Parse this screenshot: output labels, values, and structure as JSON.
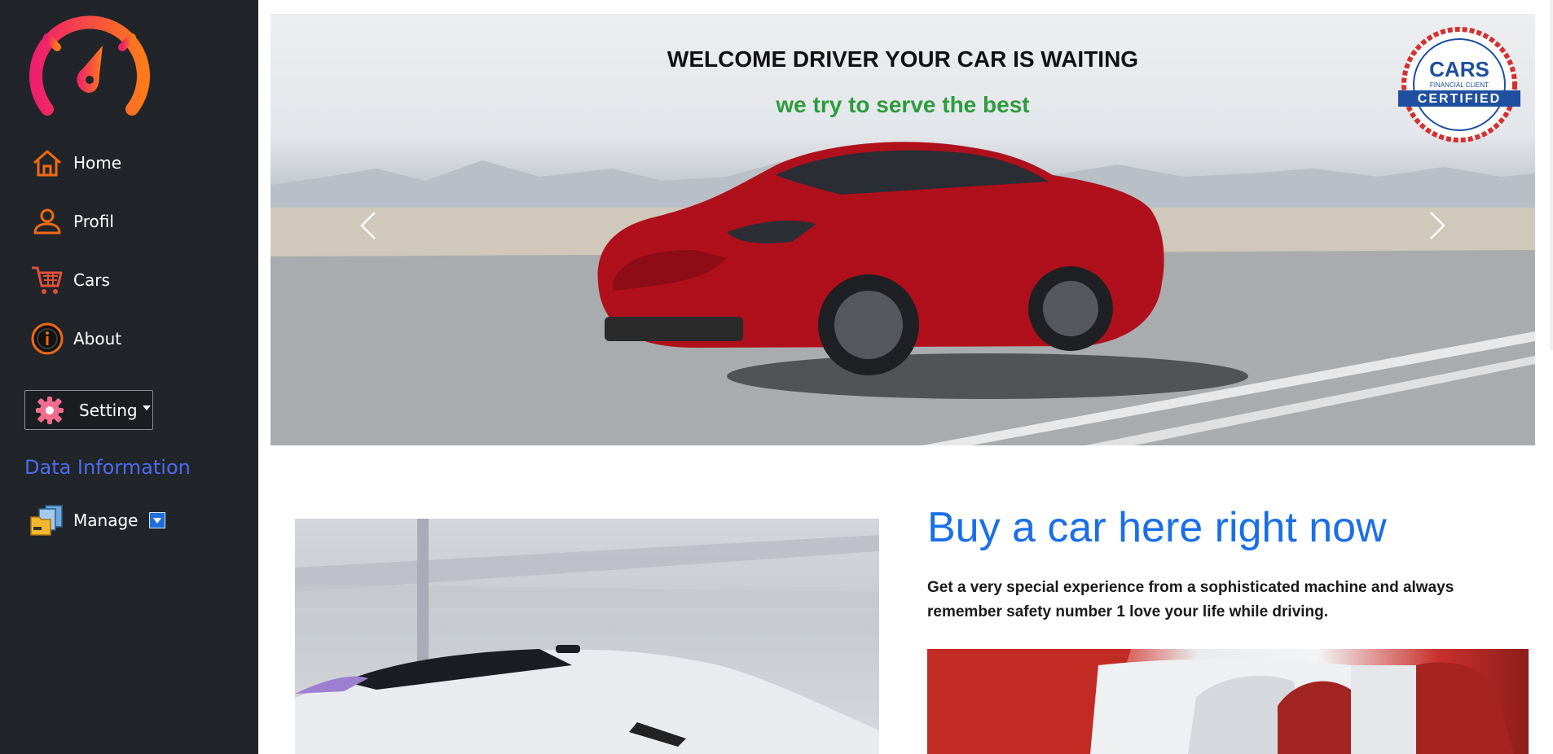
{
  "sidebar": {
    "nav": [
      {
        "label": "Home",
        "icon": "home-icon"
      },
      {
        "label": "Profil",
        "icon": "user-icon"
      },
      {
        "label": "Cars",
        "icon": "cart-icon"
      },
      {
        "label": "About",
        "icon": "info-icon"
      }
    ],
    "setting_label": "Setting",
    "section_title": "Data Information",
    "manage_label": "Manage"
  },
  "hero": {
    "title": "WELCOME DRIVER YOUR CAR IS WAITING",
    "subtitle": "we try to serve the best",
    "badge": {
      "brand": "CARS",
      "line1": "FINANCIAL CLIENT",
      "line2": "CERTIFIED"
    }
  },
  "content": {
    "heading": "Buy a car here right now",
    "text": "Get a very special experience from a sophisticated machine and always remember safety number 1 love your life while driving."
  },
  "colors": {
    "sidebar_bg": "#212529",
    "accent_orange": "#f06a12",
    "section_blue": "#4d6bf0",
    "heading_blue": "#1a6fe8",
    "subtitle_green": "#2e9b3e"
  }
}
